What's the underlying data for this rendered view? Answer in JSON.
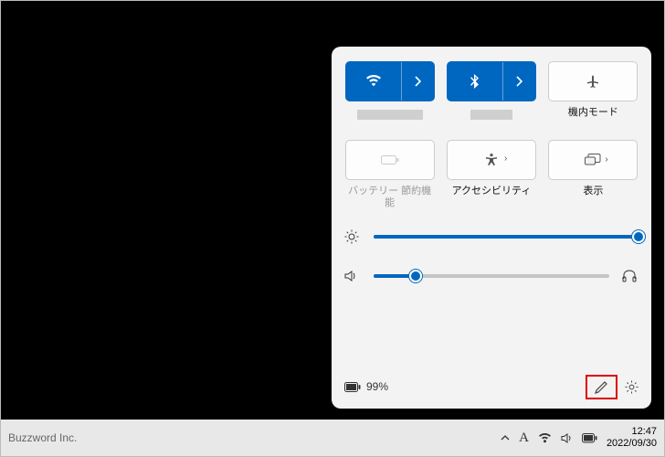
{
  "panel": {
    "tiles": [
      {
        "key": "wifi",
        "label": "",
        "redacted": true,
        "accent": true
      },
      {
        "key": "bluetooth",
        "label": "",
        "redacted": true,
        "accent": true,
        "redacted_small": true
      },
      {
        "key": "airplane",
        "label": "機内モード"
      },
      {
        "key": "battery_saver",
        "label": "バッテリー\n節約機能",
        "disabled": true
      },
      {
        "key": "accessibility",
        "label": "アクセシビリティ"
      },
      {
        "key": "project",
        "label": "表示"
      }
    ],
    "brightness_pct": 100,
    "volume_pct": 18,
    "battery_pct_text": "99%"
  },
  "taskbar": {
    "brand": "Buzzword Inc.",
    "ime": "A",
    "time": "12:47",
    "date": "2022/09/30"
  }
}
